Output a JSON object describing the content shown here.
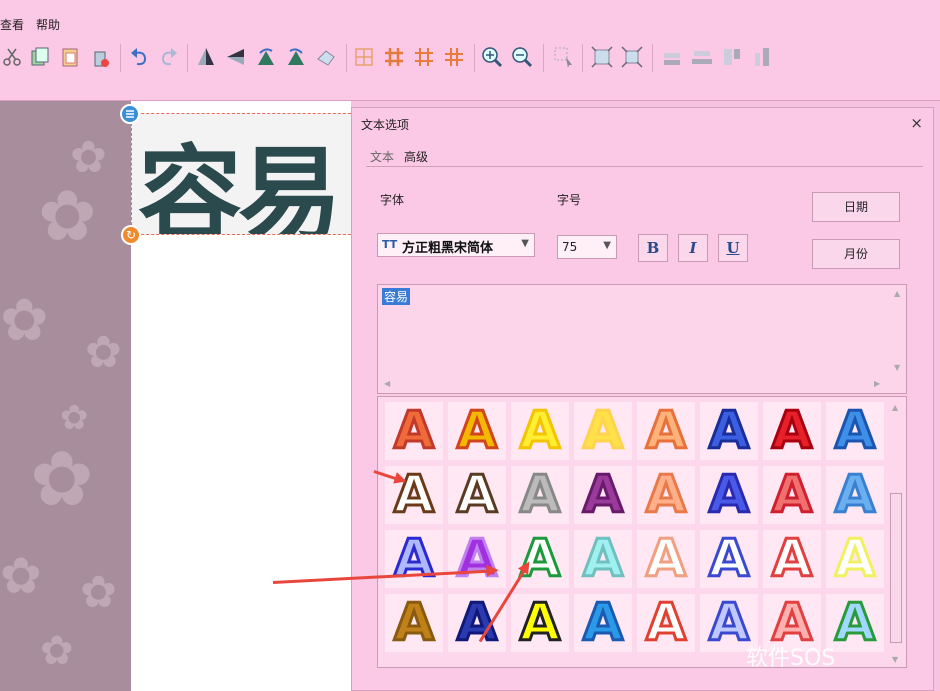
{
  "menu": [
    "查看",
    "帮助"
  ],
  "canvas": {
    "text": "容易"
  },
  "dialog": {
    "title": "文本选项",
    "close_icon": "×",
    "tabs": [
      "文本",
      "高级"
    ],
    "font_label": "字体",
    "size_label": "字号",
    "font_value": "方正粗黑宋简体",
    "size_value": "75",
    "bold": "B",
    "italic": "I",
    "underline": "U",
    "date_button": "日期",
    "month_button": "月份",
    "text_content": "容易",
    "style_glyph": "A"
  },
  "watermark": "软件SOS",
  "colors": {
    "accent_arrow": "#e9463c",
    "canvas_text": "#2b4a4d",
    "window_bg": "#fbc8e6"
  }
}
